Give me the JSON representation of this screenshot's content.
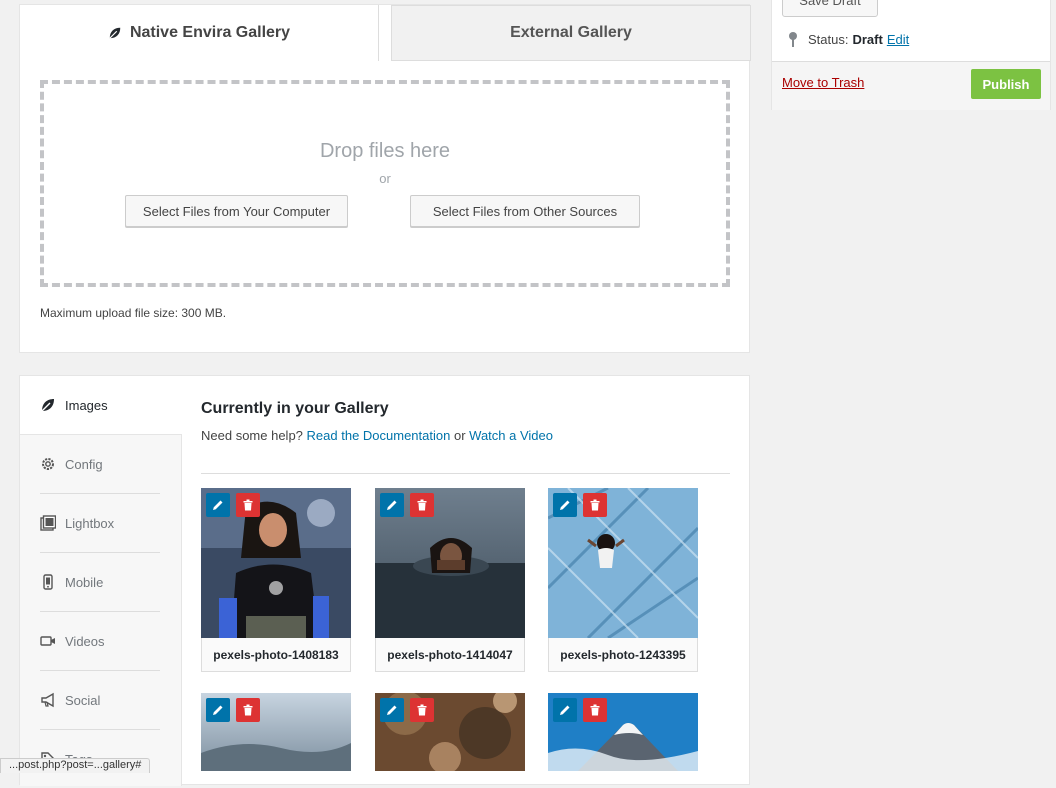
{
  "upload": {
    "tabs": [
      {
        "label": "Native Envira Gallery",
        "active": true
      },
      {
        "label": "External Gallery",
        "active": false
      }
    ],
    "drop_title": "Drop files here",
    "or_text": "or",
    "select_computer": "Select Files from Your Computer",
    "select_other": "Select Files from Other Sources",
    "max_size_note": "Maximum upload file size: 300 MB."
  },
  "publish": {
    "save_draft": "Save Draft",
    "status_label": "Status:",
    "status_value": "Draft",
    "status_edit": "Edit",
    "trash_link": "Move to Trash",
    "publish_button": "Publish"
  },
  "gallery": {
    "nav": [
      {
        "label": "Images",
        "icon": "leaf-icon"
      },
      {
        "label": "Config",
        "icon": "gear-icon"
      },
      {
        "label": "Lightbox",
        "icon": "lightbox-icon"
      },
      {
        "label": "Mobile",
        "icon": "mobile-icon"
      },
      {
        "label": "Videos",
        "icon": "video-icon"
      },
      {
        "label": "Social",
        "icon": "megaphone-icon"
      },
      {
        "label": "Tags",
        "icon": "tag-icon"
      }
    ],
    "title": "Currently in your Gallery",
    "help_prefix": "Need some help?",
    "docs_link": "Read the Documentation",
    "help_or": "or",
    "video_link": "Watch a Video",
    "images": [
      {
        "name": "pexels-photo-1408183"
      },
      {
        "name": "pexels-photo-1414047"
      },
      {
        "name": "pexels-photo-1243395"
      },
      {
        "name": ""
      },
      {
        "name": ""
      },
      {
        "name": ""
      }
    ]
  },
  "colors": {
    "accent_blue": "#0073aa",
    "delete_red": "#dd3333",
    "publish_green": "#7cc242",
    "trash_red": "#aa0000"
  },
  "statusbar": {
    "url": "...post.php?post=...gallery#"
  }
}
